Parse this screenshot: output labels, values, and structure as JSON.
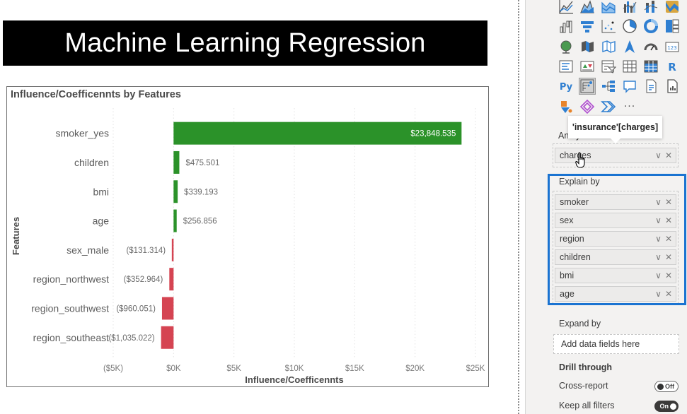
{
  "banner": {
    "title": "Machine Learning Regression"
  },
  "visual": {
    "title": "Influence/Coefficennts by Features"
  },
  "chart_data": {
    "type": "bar",
    "orientation": "horizontal",
    "title": "Influence/Coefficennts by Features",
    "xlabel": "Influence/Coefficennts",
    "ylabel": "Features",
    "xlim": [
      -5000,
      25000
    ],
    "x_ticks": [
      -5000,
      0,
      5000,
      10000,
      15000,
      20000,
      25000
    ],
    "x_tick_labels": [
      "($5K)",
      "$0K",
      "$5K",
      "$10K",
      "$15K",
      "$20K",
      "$25K"
    ],
    "grid": true,
    "categories": [
      "smoker_yes",
      "children",
      "bmi",
      "age",
      "sex_male",
      "region_northwest",
      "region_southwest",
      "region_southeast"
    ],
    "values": [
      23848.535,
      475.501,
      339.193,
      256.856,
      -131.314,
      -352.964,
      -960.051,
      -1035.022
    ],
    "data_labels": [
      "$23,848.535",
      "$475.501",
      "$339.193",
      "$256.856",
      "($131.314)",
      "($352.964)",
      "($960.051)",
      "($1,035.022)"
    ],
    "colors": {
      "positive": "#2b9229",
      "negative": "#d54452"
    }
  },
  "pane": {
    "viz_icons": [
      [
        "line-chart",
        "area-chart",
        "stacked-area-chart",
        "line-clustered-column-chart",
        "line-stacked-column-chart",
        "ribbon-chart"
      ],
      [
        "waterfall-chart",
        "funnel-chart",
        "scatter-chart",
        "pie-chart",
        "donut-chart",
        "treemap"
      ],
      [
        "map",
        "filled-map",
        "shape-map",
        "azure-map",
        "gauge",
        "card"
      ],
      [
        "multi-row-card",
        "kpi",
        "slicer",
        "table",
        "matrix",
        "r-visual"
      ],
      [
        "python-visual",
        "key-influencers",
        "decomposition-tree",
        "qa-visual",
        "smart-narrative",
        "paginated-report"
      ],
      [
        "power-apps",
        "power-automate",
        "more-visuals"
      ]
    ],
    "selected_viz": "key-influencers",
    "analyze": {
      "label": "Analyze",
      "field": "charges"
    },
    "tooltip": "'insurance'[charges]",
    "explain_by": {
      "label": "Explain by",
      "fields": [
        "smoker",
        "sex",
        "region",
        "children",
        "bmi",
        "age"
      ]
    },
    "expand_by": {
      "label": "Expand by",
      "placeholder": "Add data fields here"
    },
    "drill_through": {
      "label": "Drill through",
      "cross_report": {
        "label": "Cross-report",
        "state": "Off"
      },
      "keep_all_filters": {
        "label": "Keep all filters",
        "state": "On"
      }
    },
    "field_controls": {
      "expand": "∨",
      "remove": "✕"
    },
    "more_glyph": "···"
  },
  "colors": {
    "highlight": "#1a73d1",
    "icon_blue": "#2f7fd1"
  }
}
